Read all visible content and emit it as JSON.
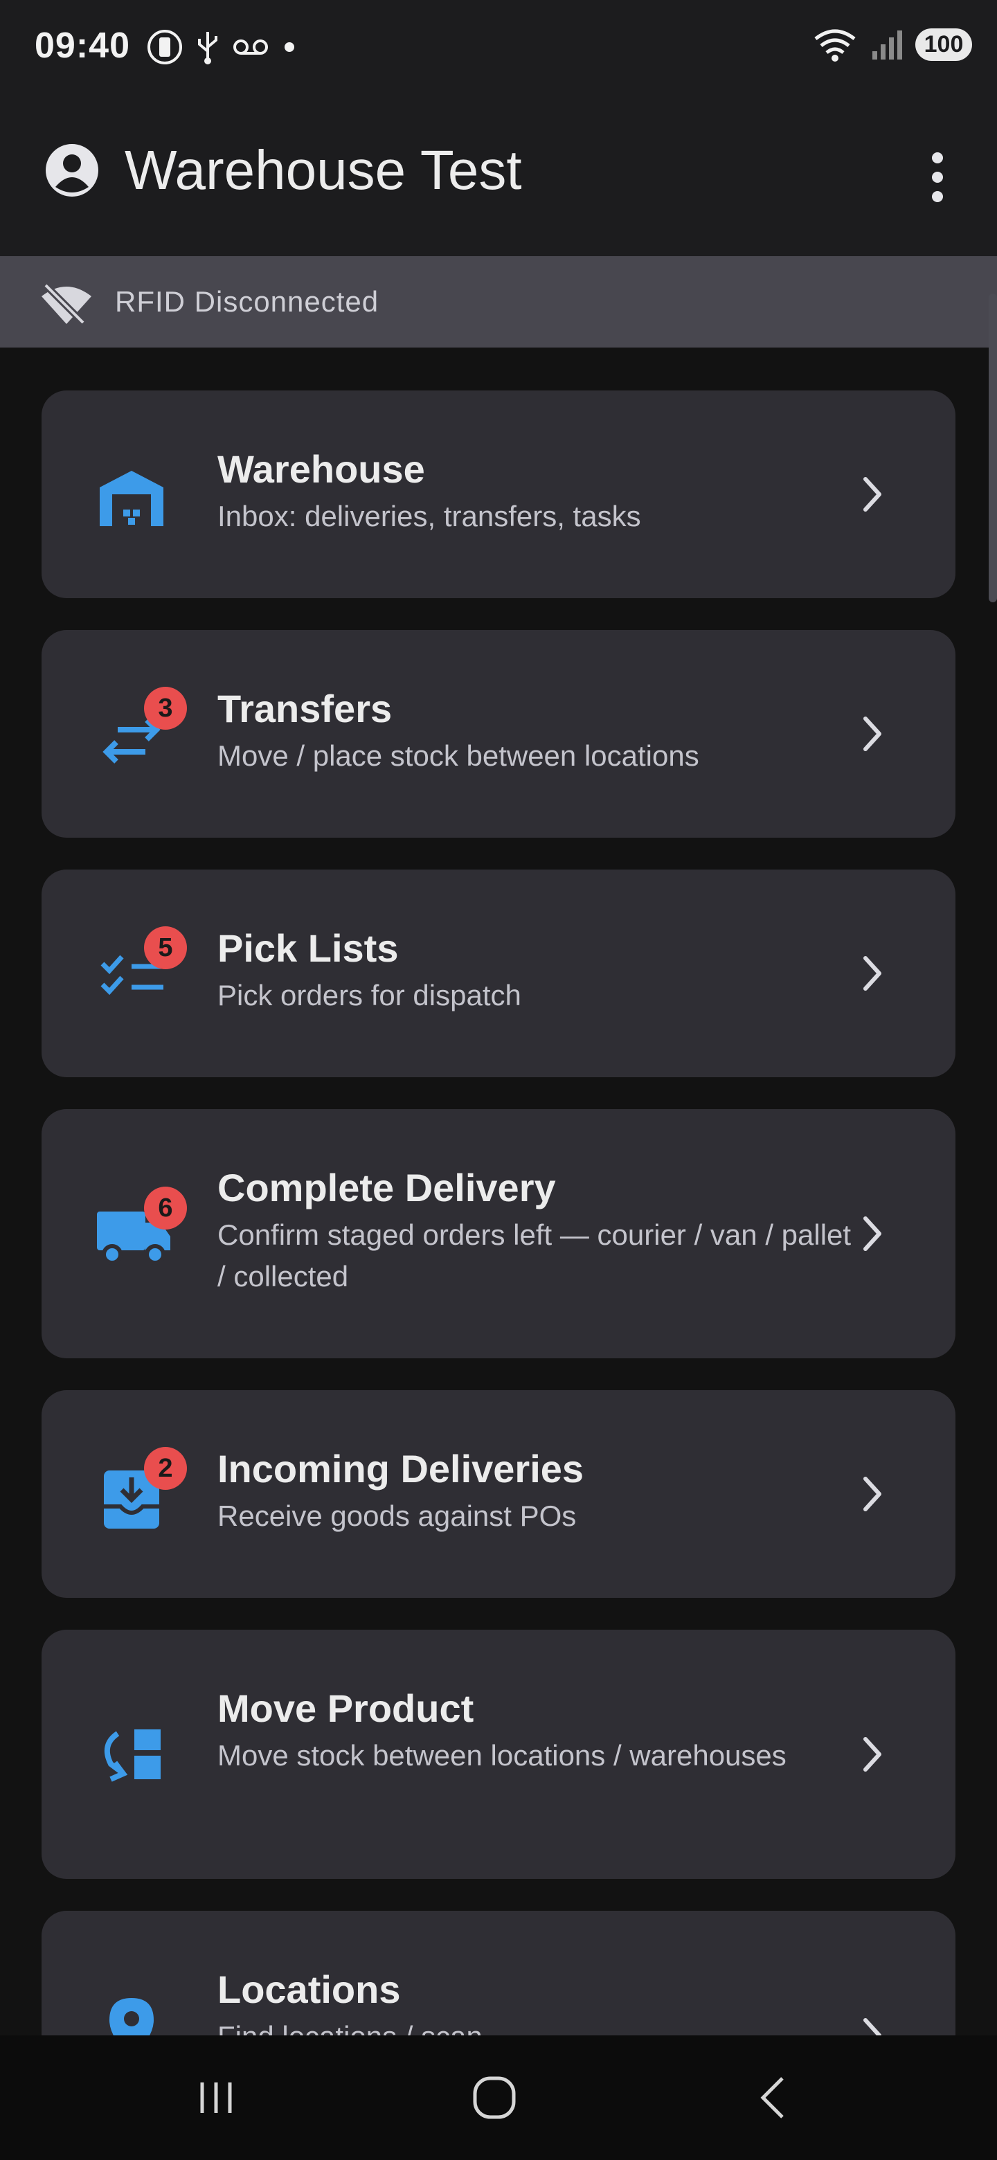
{
  "status_bar": {
    "time": "09:40",
    "left_icons": [
      "phone-icon",
      "usb-icon",
      "voicemail-icon",
      "dot-icon"
    ],
    "right_icons": [
      "wifi-icon",
      "signal-icon"
    ],
    "battery": "100"
  },
  "app_bar": {
    "title": "Warehouse Test",
    "avatar_icon": "account-circle-icon",
    "menu_icon": "more-vert-icon"
  },
  "rfid": {
    "status_text": "RFID Disconnected",
    "icon": "wifi-off-icon"
  },
  "accent_color": "#3d9be9",
  "badge_color": "#e94e4e",
  "menu": [
    {
      "title": "Warehouse",
      "subtitle": "Inbox: deliveries, transfers, tasks",
      "icon": "warehouse-icon",
      "badge": null
    },
    {
      "title": "Transfers",
      "subtitle": "Move / place stock between locations",
      "icon": "swap-arrows-icon",
      "badge": "3"
    },
    {
      "title": "Pick Lists",
      "subtitle": "Pick orders for dispatch",
      "icon": "checklist-icon",
      "badge": "5"
    },
    {
      "title": "Complete Delivery",
      "subtitle": "Confirm staged orders left — courier / van / pallet / collected",
      "icon": "truck-icon",
      "badge": "6"
    },
    {
      "title": "Incoming Deliveries",
      "subtitle": "Receive goods against POs",
      "icon": "inbox-download-icon",
      "badge": "2"
    },
    {
      "title": "Move Product",
      "subtitle": "Move stock between locations / warehouses",
      "icon": "move-product-icon",
      "badge": null
    },
    {
      "title": "Locations",
      "subtitle": "Find locations / scan",
      "icon": "location-pin-icon",
      "badge": null
    }
  ],
  "nav_bar": [
    "recent-apps-icon",
    "home-icon",
    "back-icon"
  ]
}
